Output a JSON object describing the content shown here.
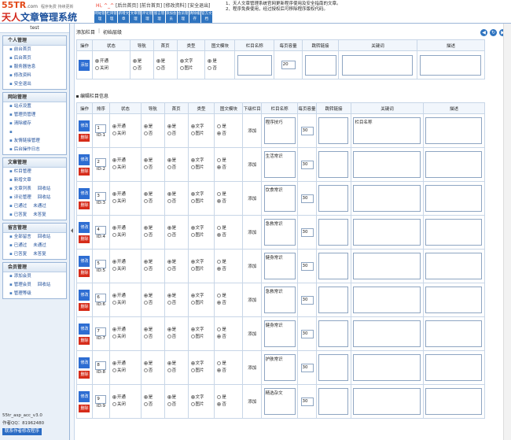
{
  "app": {
    "logo_top": "55TR",
    "logo_com": ".com",
    "logo_slogan": "程序免费 持续更新",
    "logo_sky": "天人",
    "logo_name": "文章管理系统"
  },
  "topbar": {
    "greeting": "Hi, ^_^",
    "links": "[后台首页] [前台首页] [修改资料] [安全退出]",
    "nav": [
      "网站管理",
      "栏目管理",
      "新增文章",
      "文章管理",
      "评论管理",
      "留言管理",
      "添加会员",
      "会员管理",
      "清除缓存",
      "官方文档"
    ],
    "notice1": "1、天人文章管理系统官网更新程序使用及安全指南的文章。",
    "notice2": "2、程序免费使用，经过授权后可移除程序版权代码。"
  },
  "sidebar": {
    "user": "test",
    "groups": [
      {
        "title": "个人管理",
        "items": [
          {
            "label": "前台首页",
            "extra": ""
          },
          {
            "label": "后台首页",
            "extra": ""
          },
          {
            "label": "服务器信息",
            "extra": ""
          },
          {
            "label": "修改资料",
            "extra": ""
          },
          {
            "label": "安全退出",
            "extra": ""
          }
        ]
      },
      {
        "title": "网站管理",
        "items": [
          {
            "label": "站点设置",
            "extra": ""
          },
          {
            "label": "管理员管理",
            "extra": ""
          },
          {
            "label": "清除缓存",
            "extra": ""
          },
          {
            "label": "",
            "extra": ""
          },
          {
            "label": "友情链接管理",
            "extra": ""
          },
          {
            "label": "后台操作日志",
            "extra": ""
          }
        ]
      },
      {
        "title": "文章管理",
        "items": [
          {
            "label": "栏目管理",
            "extra": ""
          },
          {
            "label": "新增文章",
            "extra": ""
          },
          {
            "label": "文章列表",
            "extra": "回收站"
          },
          {
            "label": "评论管理",
            "extra": "回收站"
          },
          {
            "label": "已通过",
            "extra": "未通过"
          },
          {
            "label": "已答复",
            "extra": "未答复"
          }
        ]
      },
      {
        "title": "留言管理",
        "items": [
          {
            "label": "全部留言",
            "extra": "回收站"
          },
          {
            "label": "已通过",
            "extra": "未通过"
          },
          {
            "label": "已答复",
            "extra": "未答复"
          }
        ]
      },
      {
        "title": "会员管理",
        "items": [
          {
            "label": "添加会员",
            "extra": ""
          },
          {
            "label": "管理会员",
            "extra": "回收站"
          },
          {
            "label": "管理等级",
            "extra": ""
          }
        ]
      }
    ],
    "version": "55tr_asp_acc_v3.0",
    "author": "作者QQ：81962480",
    "contact": "联系作者修改程序"
  },
  "main": {
    "tab_add": "添加栏目",
    "tab_init": "初始层级",
    "add_headers": [
      "操作",
      "状态",
      "导航",
      "首页",
      "类型",
      "图文模块",
      "栏目名称",
      "每页容量",
      "跳转链接",
      "关键词",
      "描述"
    ],
    "add_button": "添加",
    "add_page_size": "20",
    "section2_title": "编辑栏目信息",
    "list_headers": [
      "操作",
      "排序",
      "状态",
      "导航",
      "首页",
      "类型",
      "图文模块",
      "下级栏目",
      "栏目名称",
      "每页容量",
      "跳转链接",
      "关键词",
      "描述"
    ],
    "status_on": "开通",
    "status_off": "关闭",
    "yes": "是",
    "no": "否",
    "type_text": "文字",
    "type_image": "图片",
    "edit_label": "修改",
    "delete_label": "删除",
    "add_sub_label": "添加",
    "rows": [
      {
        "sort": "1",
        "id": "ID:1",
        "name": "程序技巧",
        "size": "30",
        "keyword": "栏目名称"
      },
      {
        "sort": "2",
        "id": "ID:2",
        "name": "生活常识",
        "size": "30",
        "keyword": ""
      },
      {
        "sort": "3",
        "id": "ID:3",
        "name": "饮食常识",
        "size": "30",
        "keyword": ""
      },
      {
        "sort": "4",
        "id": "ID:4",
        "name": "急救常识",
        "size": "30",
        "keyword": ""
      },
      {
        "sort": "5",
        "id": "ID:5",
        "name": "健身常识",
        "size": "30",
        "keyword": ""
      },
      {
        "sort": "6",
        "id": "ID:6",
        "name": "急救常识",
        "size": "30",
        "keyword": ""
      },
      {
        "sort": "7",
        "id": "ID:7",
        "name": "健身常识",
        "size": "30",
        "keyword": ""
      },
      {
        "sort": "8",
        "id": "ID:8",
        "name": "护肤常识",
        "size": "30",
        "keyword": ""
      },
      {
        "sort": "9",
        "id": "ID:9",
        "name": "精选杂文",
        "size": "30",
        "keyword": ""
      }
    ]
  }
}
